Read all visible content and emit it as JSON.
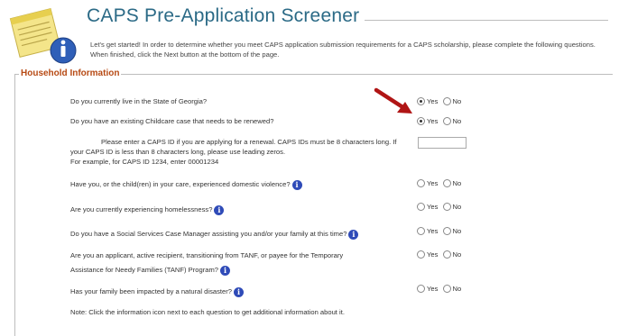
{
  "header": {
    "title": "CAPS Pre-Application Screener",
    "intro": "Let's get started! In order to determine whether you meet CAPS application submission requirements for a CAPS scholarship, please complete the following questions. When finished, click the Next button at the bottom of the page."
  },
  "section": {
    "legend": "Household Information"
  },
  "questions": [
    {
      "text": "Do you currently live in the State of Georgia?",
      "yes": "Yes",
      "no": "No",
      "selected": "yes"
    },
    {
      "text": "Do you have an existing Childcare case that needs to be renewed?",
      "yes": "Yes",
      "no": "No",
      "selected": "yes"
    },
    {
      "text": "Have you, or the child(ren) in your care, experienced domestic violence?",
      "yes": "Yes",
      "no": "No",
      "selected": "none"
    },
    {
      "text": "Are you currently experiencing homelessness?",
      "yes": "Yes",
      "no": "No",
      "selected": "none"
    },
    {
      "text": "Do you have a Social Services Case Manager assisting you and/or your family at this time?",
      "yes": "Yes",
      "no": "No",
      "selected": "none"
    },
    {
      "text_line1": "Are you an applicant, active recipient, transitioning from TANF, or payee for the Temporary",
      "text_line2": "Assistance for Needy Families (TANF) Program?",
      "yes": "Yes",
      "no": "No",
      "selected": "none"
    },
    {
      "text": "Has your family been impacted by a natural disaster?",
      "yes": "Yes",
      "no": "No",
      "selected": "none"
    }
  ],
  "caps_id": {
    "line1": "Please enter a CAPS ID if you are applying for a renewal. CAPS IDs must be 8 characters long. If",
    "line2": "your CAPS ID is less than 8 characters long, please use leading zeros.",
    "line3": "For example, for CAPS ID 1234, enter 00001234",
    "value": ""
  },
  "note": "Note: Click the information icon next to each question to get additional information about it.",
  "icons": {
    "info": "i",
    "logo": "notepad-info-icon",
    "arrow": "red-arrow-annotation"
  },
  "colors": {
    "title": "#2b6a86",
    "legend": "#b74a14",
    "info_icon": "#2f4bb8",
    "arrow": "#b01515"
  }
}
